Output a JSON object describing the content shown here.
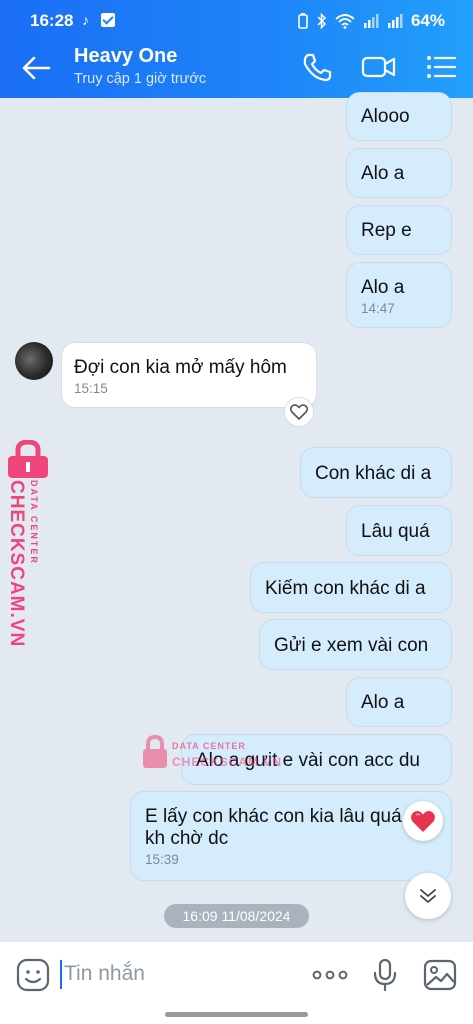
{
  "status_bar": {
    "time": "16:28",
    "battery": "64%"
  },
  "header": {
    "title": "Heavy One",
    "subtitle": "Truy cập 1 giờ trước"
  },
  "messages": [
    {
      "dir": "out",
      "text": "Alooo"
    },
    {
      "dir": "out",
      "text": "Alo a"
    },
    {
      "dir": "out",
      "text": "Rep e"
    },
    {
      "dir": "out",
      "text": "Alo a",
      "time": "14:47"
    },
    {
      "dir": "in",
      "text": "Đợi con kia mở mấy hôm",
      "time": "15:15"
    },
    {
      "dir": "out",
      "text": "Con khác di a"
    },
    {
      "dir": "out",
      "text": "Lâu quá"
    },
    {
      "dir": "out",
      "text": "Kiếm con khác di a"
    },
    {
      "dir": "out",
      "text": "Gửi e xem vài con"
    },
    {
      "dir": "out",
      "text": "Alo a"
    },
    {
      "dir": "out",
      "text": "Alo a gưit e vài con acc du"
    },
    {
      "dir": "out",
      "text": "E lấy con khác con kia lâu quá",
      "text2": "kh chờ dc",
      "time": "15:39"
    }
  ],
  "date_separator": "16:09 11/08/2024",
  "watermark": {
    "brand": "CHECKSCAM.VN",
    "tag": "DATA CENTER",
    "center_tag": "DATA CENTER",
    "center_brand": "CHECKSCAM.VN"
  },
  "input": {
    "placeholder": "Tin nhắn"
  },
  "colors": {
    "header_start": "#1a6ef5",
    "header_end": "#22a0fb",
    "outgoing_bubble": "#d4ecfc",
    "incoming_bubble": "#ffffff",
    "watermark": "#f0457a"
  },
  "icons": [
    "back-arrow-icon",
    "phone-icon",
    "video-call-icon",
    "menu-icon",
    "heart-outline-icon",
    "heart-reaction-icon",
    "chevron-double-down-icon",
    "emoji-icon",
    "more-icon",
    "microphone-icon",
    "image-icon"
  ]
}
